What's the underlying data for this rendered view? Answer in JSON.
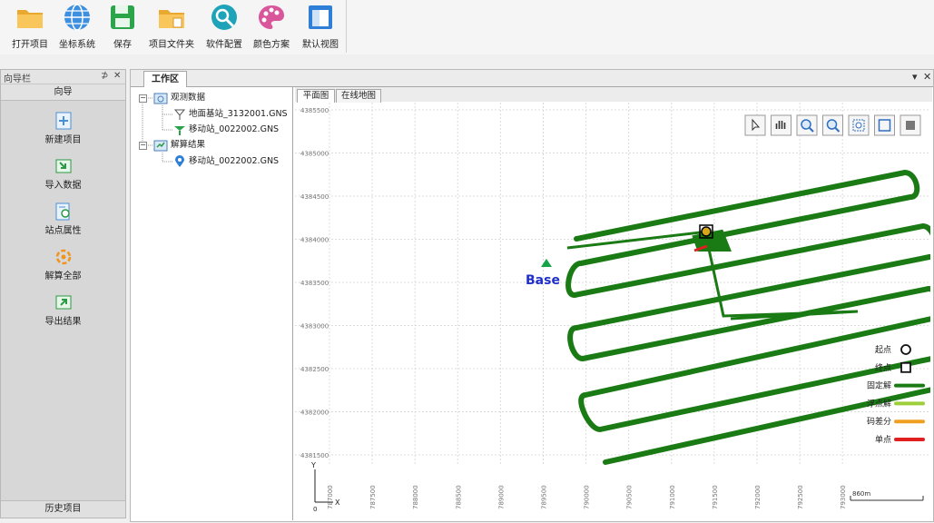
{
  "toolbar": {
    "buttons": [
      {
        "label": "打开项目",
        "icon": "folder-open-icon"
      },
      {
        "label": "坐标系统",
        "icon": "globe-icon"
      },
      {
        "label": "保存",
        "icon": "save-icon"
      },
      {
        "label": "项目文件夹",
        "icon": "project-folder-icon"
      },
      {
        "label": "软件配置",
        "icon": "satellite-settings-icon"
      },
      {
        "label": "颜色方案",
        "icon": "palette-icon"
      },
      {
        "label": "默认视图",
        "icon": "default-view-icon"
      }
    ]
  },
  "nav": {
    "panel_title": "向导栏",
    "pin": "⊅",
    "close": "✕",
    "header": "向导",
    "items": [
      {
        "label": "新建项目",
        "icon": "new-project-icon"
      },
      {
        "label": "导入数据",
        "icon": "import-data-icon"
      },
      {
        "label": "站点属性",
        "icon": "station-properties-icon"
      },
      {
        "label": "解算全部",
        "icon": "solve-all-icon"
      },
      {
        "label": "导出结果",
        "icon": "export-results-icon"
      }
    ],
    "footer": "历史项目"
  },
  "workspace": {
    "tab": "工作区",
    "menu": "▾",
    "close": "✕",
    "tree": {
      "observation_group": "观测数据",
      "base_file": "地面基站_3132001.GNS",
      "rover_file": "移动站_0022002.GNS",
      "result_group": "解算结果",
      "result_file": "移动站_0022002.GNS"
    },
    "view_tabs": [
      "平面图",
      "在线地图"
    ]
  },
  "colors": {
    "track_fixed": "#1a7a14",
    "float": "#9ccf3a",
    "dgps": "#f0a020",
    "single": "#e02020",
    "base_marker": "#16a34a",
    "base_label": "#1f2fc8"
  },
  "map": {
    "base_label": "Base",
    "y_ticks": [
      "4385500",
      "4385000",
      "4384500",
      "4384000",
      "4383500",
      "4383000",
      "4382500",
      "4382000",
      "4381500"
    ],
    "x_ticks": [
      "787000",
      "787500",
      "788000",
      "788500",
      "789000",
      "789500",
      "790000",
      "790500",
      "791000",
      "791500",
      "792000",
      "792500",
      "793000"
    ],
    "axis_y": "Y",
    "axis_x": "X",
    "origin": "0",
    "scale_label": "860m",
    "tools": [
      "pointer-tool-icon",
      "pan-tool-icon",
      "zoom-in-tool-icon",
      "zoom-out-tool-icon",
      "zoom-window-tool-icon",
      "full-extent-tool-icon",
      "layer-tool-icon"
    ],
    "legend": [
      {
        "label": "起点",
        "type": "circle"
      },
      {
        "label": "终点",
        "type": "square"
      },
      {
        "label": "固定解",
        "type": "line",
        "color": "#1a7a14"
      },
      {
        "label": "浮点解",
        "type": "line",
        "color": "#9ccf3a"
      },
      {
        "label": "码差分",
        "type": "line",
        "color": "#f0a020"
      },
      {
        "label": "单点",
        "type": "line",
        "color": "#e02020"
      }
    ]
  }
}
